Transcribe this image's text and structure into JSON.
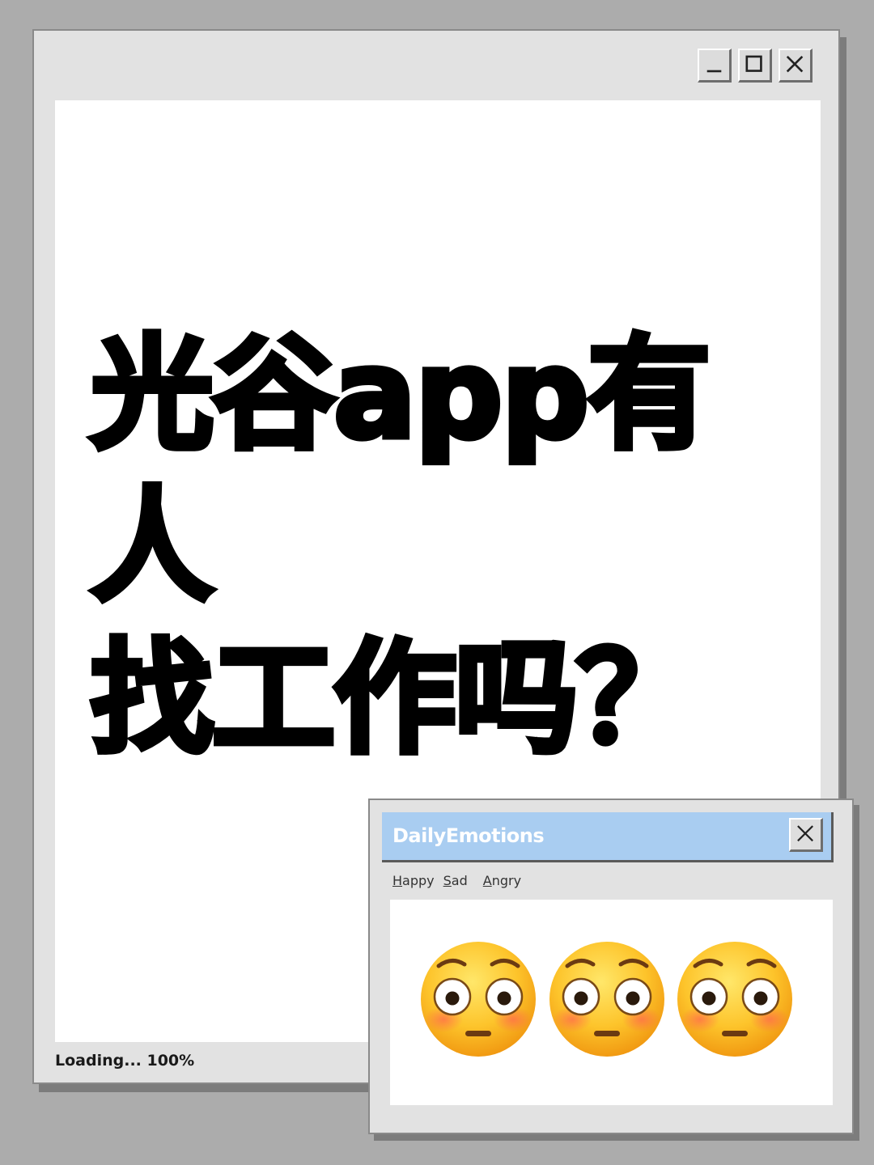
{
  "main_window": {
    "controls": {
      "minimize_icon": "minimize-icon",
      "maximize_icon": "maximize-icon",
      "close_icon": "close-icon"
    },
    "headline_line1": "光谷app有人",
    "headline_line2": "找工作吗？",
    "status": "Loading... 100%"
  },
  "dialog": {
    "title": "DailyEmotions",
    "titlebar_color": "#a9cdf1",
    "close_icon": "close-icon",
    "menu": [
      {
        "mnemonic": "H",
        "rest": "appy"
      },
      {
        "mnemonic": "S",
        "rest": "ad"
      },
      {
        "mnemonic": "A",
        "rest": "ngry"
      }
    ],
    "emojis": [
      "flushed-face-icon",
      "flushed-face-icon",
      "flushed-face-icon"
    ]
  }
}
